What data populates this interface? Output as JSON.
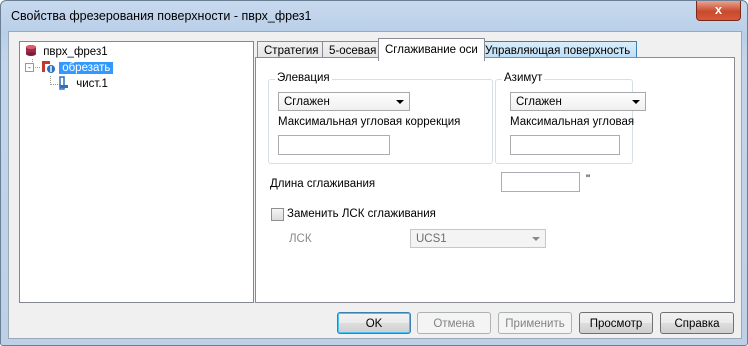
{
  "window": {
    "title": "Свойства фрезерования поверхности - пврх_фрез1",
    "close_label": "x"
  },
  "tree": {
    "root": "пврх_фрез1",
    "items": [
      {
        "label": "обрезать",
        "selected": true
      },
      {
        "label": "чист.1",
        "selected": false
      }
    ]
  },
  "tabs": [
    {
      "label": "Стратегия",
      "active": false
    },
    {
      "label": "5-осевая",
      "active": false
    },
    {
      "label": "Сглаживание оси",
      "active": true
    },
    {
      "label": "Управляющая поверхность",
      "active": false
    }
  ],
  "elevation": {
    "title": "Элевация",
    "select_value": "Сглажен",
    "correction_label": "Максимальная угловая коррекция",
    "correction_value": ""
  },
  "azimuth": {
    "title": "Азимут",
    "select_value": "Сглажен",
    "correction_label": "Максимальная угловая",
    "correction_value": ""
  },
  "smoothing_length": {
    "label": "Длина сглаживания",
    "value": "",
    "unit": "\""
  },
  "replace_ucs": {
    "label": "Заменить ЛСК сглаживания",
    "checked": false
  },
  "ucs": {
    "label": "ЛСК",
    "value": "UCS1"
  },
  "buttons": {
    "ok": "OK",
    "cancel": "Отмена",
    "apply": "Применить",
    "preview": "Просмотр",
    "help": "Справка"
  }
}
